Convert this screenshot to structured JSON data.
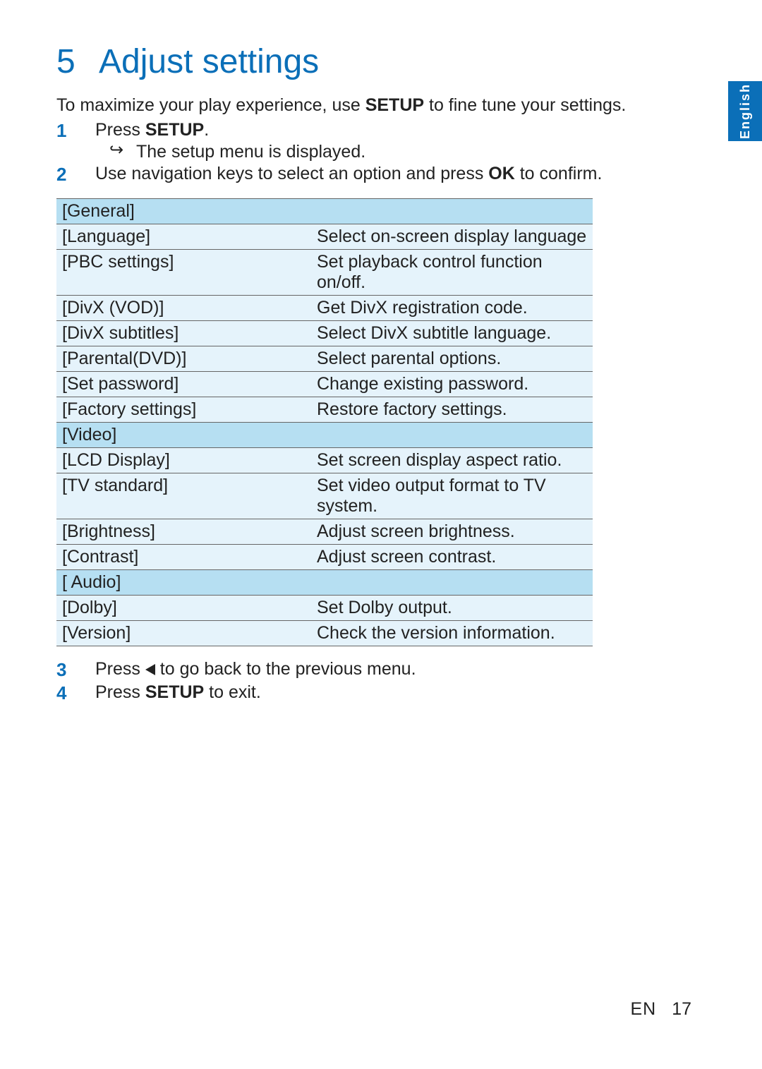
{
  "language_tab": "English",
  "heading": {
    "number": "5",
    "title": "Adjust settings"
  },
  "intro": {
    "pre": "To maximize your play experience, use ",
    "bold": "SETUP",
    "post": " to fine tune your settings."
  },
  "steps": {
    "s1": {
      "num": "1",
      "pre": "Press ",
      "bold": "SETUP",
      "post": ".",
      "sub": "The setup menu is displayed."
    },
    "s2": {
      "num": "2",
      "pre": "Use navigation keys to select an option and press ",
      "bold": "OK",
      "post": " to confirm."
    },
    "s3": {
      "num": "3",
      "pre": "Press ",
      "post": " to go back to the previous menu."
    },
    "s4": {
      "num": "4",
      "pre": "Press ",
      "bold": "SETUP",
      "post": " to exit."
    }
  },
  "table": {
    "general": {
      "label": "[General]"
    },
    "language": {
      "label": "[Language]",
      "desc": "Select on-screen display language"
    },
    "pbc": {
      "label": "[PBC settings]",
      "desc": "Set playback control function on/off."
    },
    "divxvod": {
      "label": "[DivX (VOD)]",
      "desc": "Get DivX registration code."
    },
    "divxsub": {
      "label": "[DivX subtitles]",
      "desc": "Select DivX subtitle language."
    },
    "parental": {
      "label": "[Parental(DVD)]",
      "desc": "Select parental options."
    },
    "setpw": {
      "label": "[Set password]",
      "desc": "Change existing password."
    },
    "factory": {
      "label": "[Factory settings]",
      "desc": "Restore factory settings."
    },
    "video": {
      "label": "[Video]"
    },
    "lcd": {
      "label": "[LCD Display]",
      "desc": "Set screen display aspect ratio."
    },
    "tvstd": {
      "label": "[TV standard]",
      "desc": "Set video output format to TV system."
    },
    "bright": {
      "label": "[Brightness]",
      "desc": "Adjust screen brightness."
    },
    "contrast": {
      "label": "[Contrast]",
      "desc": "Adjust screen contrast."
    },
    "audio": {
      "label": "[ Audio]"
    },
    "dolby": {
      "label": "[Dolby]",
      "desc": "Set Dolby output."
    },
    "version": {
      "label": "[Version]",
      "desc": "Check the version information."
    }
  },
  "footer": {
    "lang": "EN",
    "page": "17"
  }
}
